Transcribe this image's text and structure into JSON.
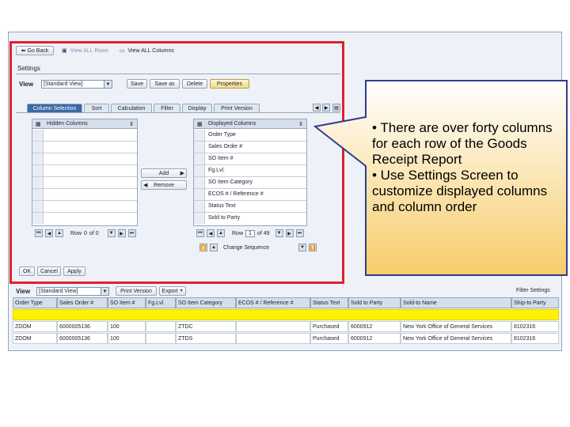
{
  "toolbar": {
    "go_back": "Go Back",
    "view_all_rows": "View ALL Rows",
    "view_all_columns": "View ALL Columns"
  },
  "settings": {
    "title": "Settings",
    "view_label": "View",
    "view_value": "[Standard View]",
    "buttons": [
      "Save",
      "Save as",
      "Delete",
      "Properties"
    ],
    "tabs": [
      "Column Selection",
      "Sort",
      "Calculation",
      "Filter",
      "Display",
      "Print Version"
    ],
    "hidden_columns_header": "Hidden Columns",
    "displayed_columns_header": "Displayed Columns",
    "displayed_columns": [
      "Order Type",
      "Sales Order #",
      "SO Item #",
      "Fg.Lvl.",
      "SO Item Category",
      "ECOS # / Reference #",
      "Status Text",
      "Sold to Party"
    ],
    "add_label": "Add",
    "remove_label": "Remove",
    "row_label_left": "Row",
    "row_value_left": "0",
    "of_left": "of 0",
    "row_label_right": "Row",
    "row_value_right": "1",
    "of_right": "of 49",
    "change_sequence": "Change Sequence",
    "ok": "OK",
    "cancel": "Cancel",
    "apply": "Apply"
  },
  "lower": {
    "view_label": "View",
    "view_value": "[Standard View]",
    "print_version": "Print Version",
    "export": "Export",
    "filter_settings": "Filter Settings"
  },
  "table": {
    "headers": [
      "Order Type",
      "Sales Order #",
      "SO Item #",
      "Fg.Lvl.",
      "SO Item Category",
      "ECOS # / Reference #",
      "Status Text",
      "Sold to Party",
      "Sold-to Name",
      "Ship-to Party"
    ],
    "rows": [
      [
        "ZDOM",
        "6000005136",
        "100",
        "",
        "ZTDC",
        "",
        "Purchased",
        "6000912",
        "New York Office of General Services",
        "8102316"
      ],
      [
        "ZDOM",
        "6000005136",
        "100",
        "",
        "ZTDS",
        "",
        "Purchased",
        "6000912",
        "New York Office of General Services",
        "8102316"
      ]
    ]
  },
  "callout": {
    "bullet1": "• There are over forty columns for each row of the Goods Receipt Report",
    "bullet2": "• Use Settings Screen to customize displayed columns and column order"
  },
  "colors": {
    "highlight_border": "#e3202a",
    "callout_fill_start": "#ffffff",
    "callout_fill_end": "#f7cc6a",
    "selected_row": "#fff200"
  }
}
